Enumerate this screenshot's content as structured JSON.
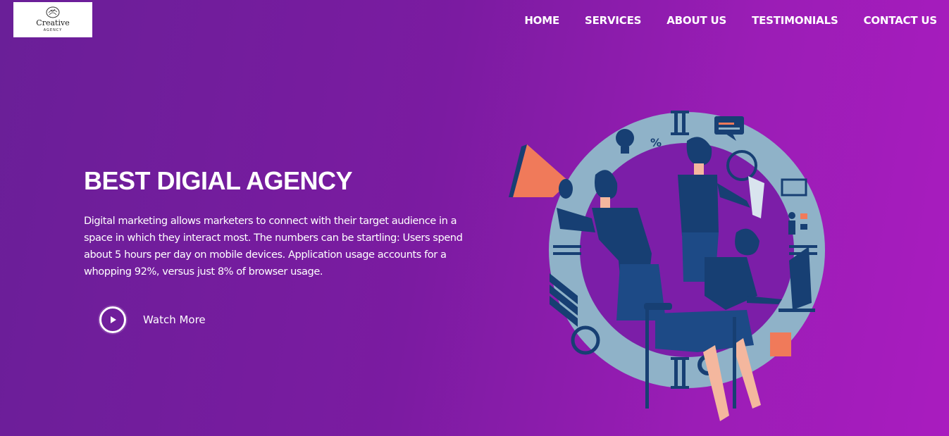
{
  "logo": {
    "title": "Creative",
    "subtitle": "AGENCY"
  },
  "nav": {
    "items": [
      "HOME",
      "SERVICES",
      "ABOUT US",
      "TESTIMONIALS",
      "CONTACT US"
    ]
  },
  "hero": {
    "title": "BEST DIGIAL AGENCY",
    "description": "Digital marketing allows marketers to connect with their target audience in a space in which they interact most. The numbers can be startling: Users spend about 5 hours per day on mobile devices. Application usage accounts for a whopping 92%, versus just 8% of browser usage.",
    "cta_label": "Watch More",
    "cta_icon": "play-icon"
  },
  "illustration": {
    "icon": "clock-team-illustration",
    "percent_symbol": "%"
  },
  "colors": {
    "bg_start": "#6a1f98",
    "bg_end": "#a91cbf",
    "circle": "#8fb2c8",
    "navy": "#173f73",
    "accent": "#f07a5a"
  }
}
